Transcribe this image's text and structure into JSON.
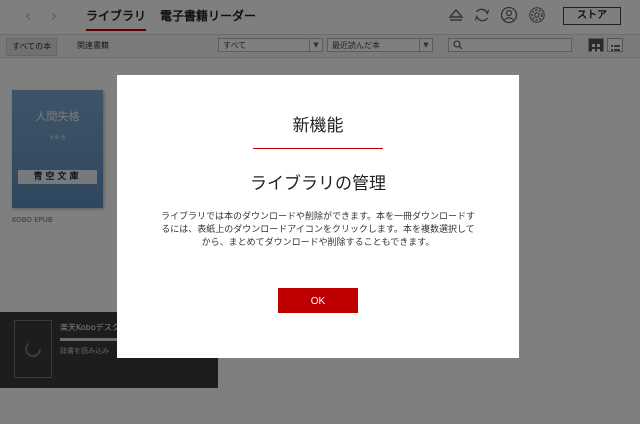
{
  "nav": {
    "tabs": [
      {
        "label": "ライブラリ",
        "active": true
      },
      {
        "label": "電子書籍リーダー",
        "active": false
      }
    ],
    "store_label": "ストア",
    "icons": [
      "eject-icon",
      "sync-icon",
      "user-icon",
      "gear-icon"
    ]
  },
  "filterbar": {
    "chips": [
      "すべての本",
      "関連書籍"
    ],
    "filter_select": "すべて",
    "sort_select": "最近読んだ本"
  },
  "library": {
    "book": {
      "cover_title": "人間失格",
      "cover_author": "太宰 治",
      "cover_publisher": "青空文庫",
      "label": "KOBO EPUB"
    }
  },
  "sync": {
    "title": "楽天Koboデスク",
    "status": "辞書を読み込み"
  },
  "modal": {
    "heading": "新機能",
    "subheading": "ライブラリの管理",
    "body": "ライブラリでは本のダウンロードや削除ができます。本を一冊ダウンロードするには、表紙上のダウンロードアイコンをクリックします。本を複数選択してから、まとめてダウンロードや削除することもできます。",
    "ok_label": "OK"
  },
  "colors": {
    "accent": "#bf0000",
    "overlay": "rgba(0,0,0,0.5)",
    "cover": "#6d9ac6"
  }
}
